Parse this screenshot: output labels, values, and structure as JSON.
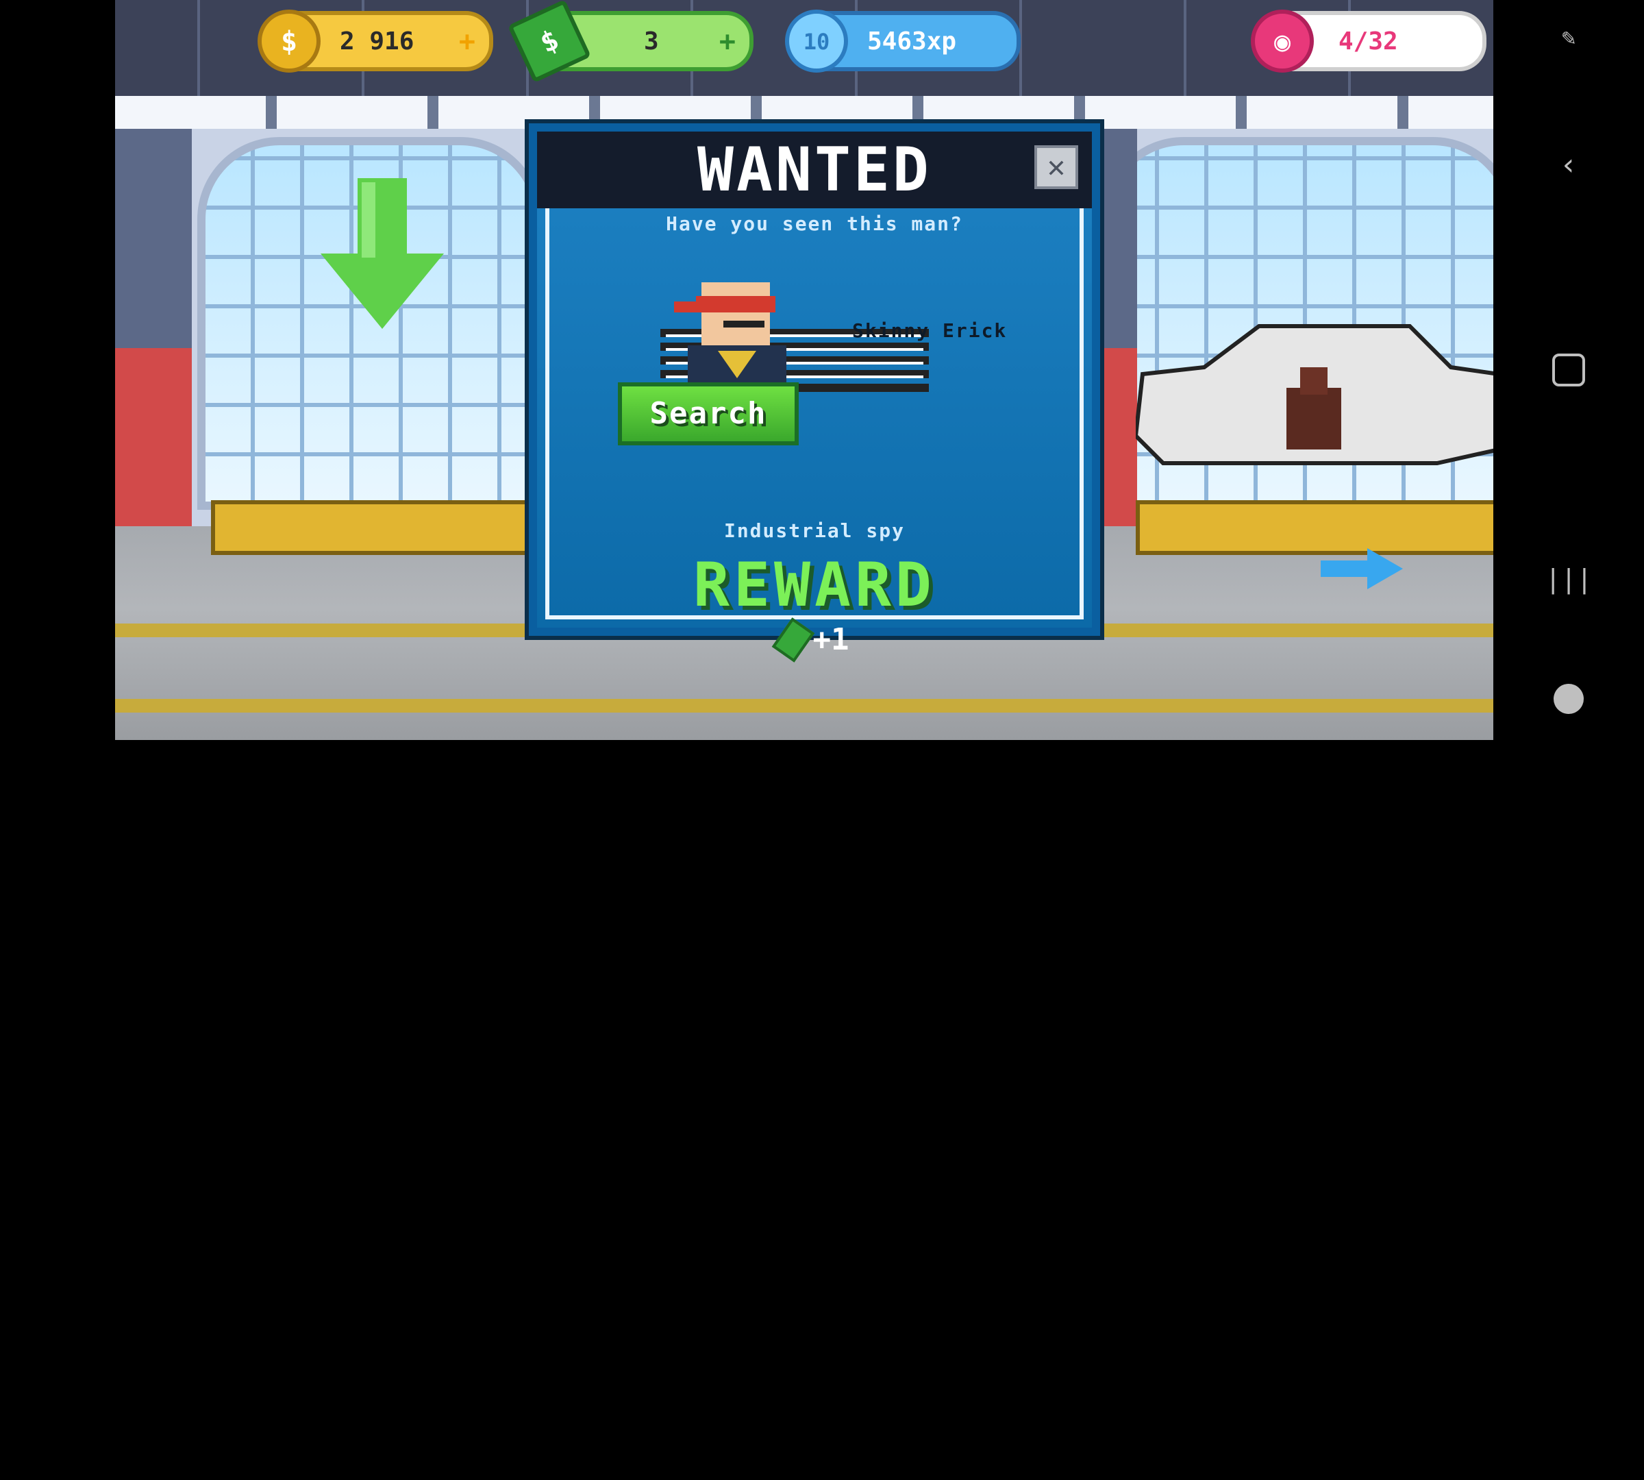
{
  "hud": {
    "coins": "2 916",
    "cash": "3",
    "level": "10",
    "xp": "5463xp",
    "donuts": "4/32",
    "plus": "+"
  },
  "modal": {
    "title": "WANTED",
    "close": "✕",
    "question": "Have you seen this man?",
    "suspect_name": "Skinny Erick",
    "role": "Industrial spy",
    "reward_label": "REWARD",
    "reward_amount": "+1",
    "search_button": "Search"
  },
  "colors": {
    "accent_green": "#7cf058",
    "modal_blue": "#1e82c4",
    "title_bar": "#141c2c"
  },
  "icons": [
    "coin-icon",
    "cash-icon",
    "level-star-icon",
    "donut-icon",
    "close-icon",
    "cash-reward-icon",
    "down-arrow-icon",
    "right-arrow-icon",
    "screenshot-icon",
    "back-icon",
    "home-icon",
    "recents-icon",
    "gamepad-icon"
  ]
}
